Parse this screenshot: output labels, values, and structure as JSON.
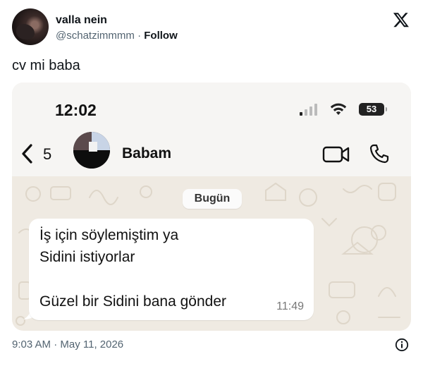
{
  "tweet": {
    "author_name": "valla nein",
    "author_handle": "@schatzimmmm",
    "separator": "·",
    "follow_label": "Follow",
    "text": "cv mi baba",
    "timestamp": "9:03 AM · May 11, 2026"
  },
  "screenshot": {
    "status_bar": {
      "time": "12:02",
      "battery": "53"
    },
    "chat_header": {
      "back_count": "5",
      "contact_name": "Babam"
    },
    "date_label": "Bugün",
    "message": {
      "lines": [
        "İş için söylemiştim ya",
        "Sidini istiyorlar",
        "Güzel bir Sidini bana gönder"
      ],
      "time": "11:49"
    }
  },
  "colors": {
    "chat_background": "#efeae2",
    "bubble": "#ffffff",
    "secondary_text": "#536471"
  },
  "icons": {
    "x_logo": "x-logo-icon",
    "back": "chevron-left-icon",
    "video": "video-call-icon",
    "call": "phone-icon",
    "info": "info-icon",
    "signal": "signal-icon",
    "wifi": "wifi-icon"
  }
}
